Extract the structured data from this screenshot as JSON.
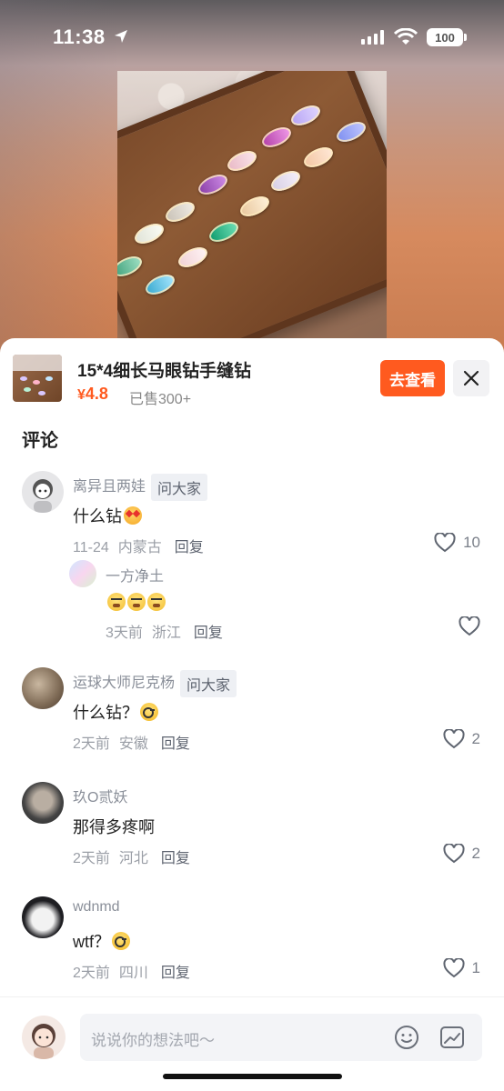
{
  "status_bar": {
    "time": "11:38",
    "battery": "100"
  },
  "product": {
    "title": "15*4细长马眼钻手缝钻",
    "price_symbol": "¥",
    "price": "4.8",
    "sold": "已售300+",
    "view_button": "去查看"
  },
  "comments_title": "评论",
  "comments": [
    {
      "user": "离异且两娃",
      "tag": "问大家",
      "text": "什么钻",
      "emoji": "star-struck-emoji",
      "date": "11-24",
      "location": "内蒙古",
      "reply": "回复",
      "likes": "10"
    },
    {
      "user": "运球大师尼克杨",
      "tag": "问大家",
      "text": "什么钻？",
      "emoji": "monocle-emoji",
      "date": "2天前",
      "location": "安徽",
      "reply": "回复",
      "likes": "2"
    },
    {
      "user": "玖O贰妖",
      "text": "那得多疼啊",
      "date": "2天前",
      "location": "河北",
      "reply": "回复",
      "likes": "2"
    },
    {
      "user": "wdnmd",
      "text": "wtf？",
      "emoji": "monocle-emoji",
      "date": "2天前",
      "location": "四川",
      "reply": "回复",
      "likes": "1"
    }
  ],
  "sub_reply": {
    "user": "一方净土",
    "emoji": "grimacing-emoji-x3",
    "date": "3天前",
    "location": "浙江",
    "reply": "回复"
  },
  "input": {
    "placeholder": "说说你的想法吧～"
  },
  "colors": {
    "accent": "#ff5a1f",
    "muted": "#8a8f99"
  }
}
